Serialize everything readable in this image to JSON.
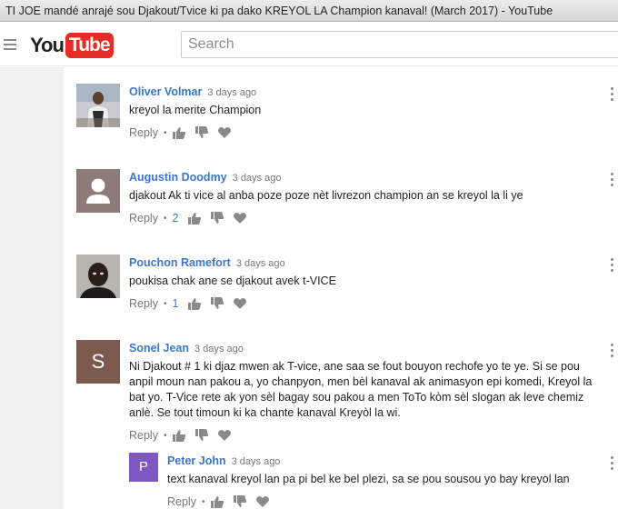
{
  "window": {
    "title": "TI JOE mandé anrajé sou Djakout/Tvice ki pa dako KREYOL LA Champion kanaval! (March 2017) - YouTube"
  },
  "header": {
    "logo_you": "You",
    "logo_tube": "Tube",
    "search_placeholder": "Search"
  },
  "colors": {
    "brand_red": "#e52d27",
    "link_blue": "#3b77cd",
    "meta_gray": "#767676"
  },
  "comments": [
    {
      "author": "Oliver Volmar",
      "time": "3 days ago",
      "text": "kreyol la merite Champion",
      "reply_label": "Reply",
      "likes": "",
      "avatar": "photo"
    },
    {
      "author": "Augustin Doodmy",
      "time": "3 days ago",
      "text": "djakout Ak ti vice al anba poze poze nèt livrezon champion an se kreyol la li ye",
      "reply_label": "Reply",
      "likes": "2",
      "avatar": "default-silhouette"
    },
    {
      "author": "Pouchon Ramefort",
      "time": "3 days ago",
      "text": "poukisa chak ane se djakout avek t-VICE",
      "reply_label": "Reply",
      "likes": "1",
      "avatar": "photo"
    },
    {
      "author": "Sonel Jean",
      "time": "3 days ago",
      "text_lines": [
        "Ni Djakout # 1 ki djaz mwen ak T-vice, ane saa se fout bouyon rechofe yo te ye. Si se pou",
        "anpil moun nan pakou a, yo chanpyon, men bèl kanaval ak animasyon epi komedi, Kreyol la",
        "bat yo. T-Vice rete ak yon sèl bagay sou pakou a men ToTo kòm sèl slogan ak leve chemiz",
        "anlè. Se tout timoun ki ka chante kanaval Kreyòl la wi."
      ],
      "reply_label": "Reply",
      "likes": "",
      "avatar_letter": "S"
    }
  ],
  "reply": {
    "author": "Peter John",
    "time": "3 days ago",
    "text": "text kanaval kreyol lan pa pi bel ke bel plezi, sa se pou sousou yo bay kreyol lan",
    "reply_label": "Reply",
    "avatar_letter": "P"
  }
}
